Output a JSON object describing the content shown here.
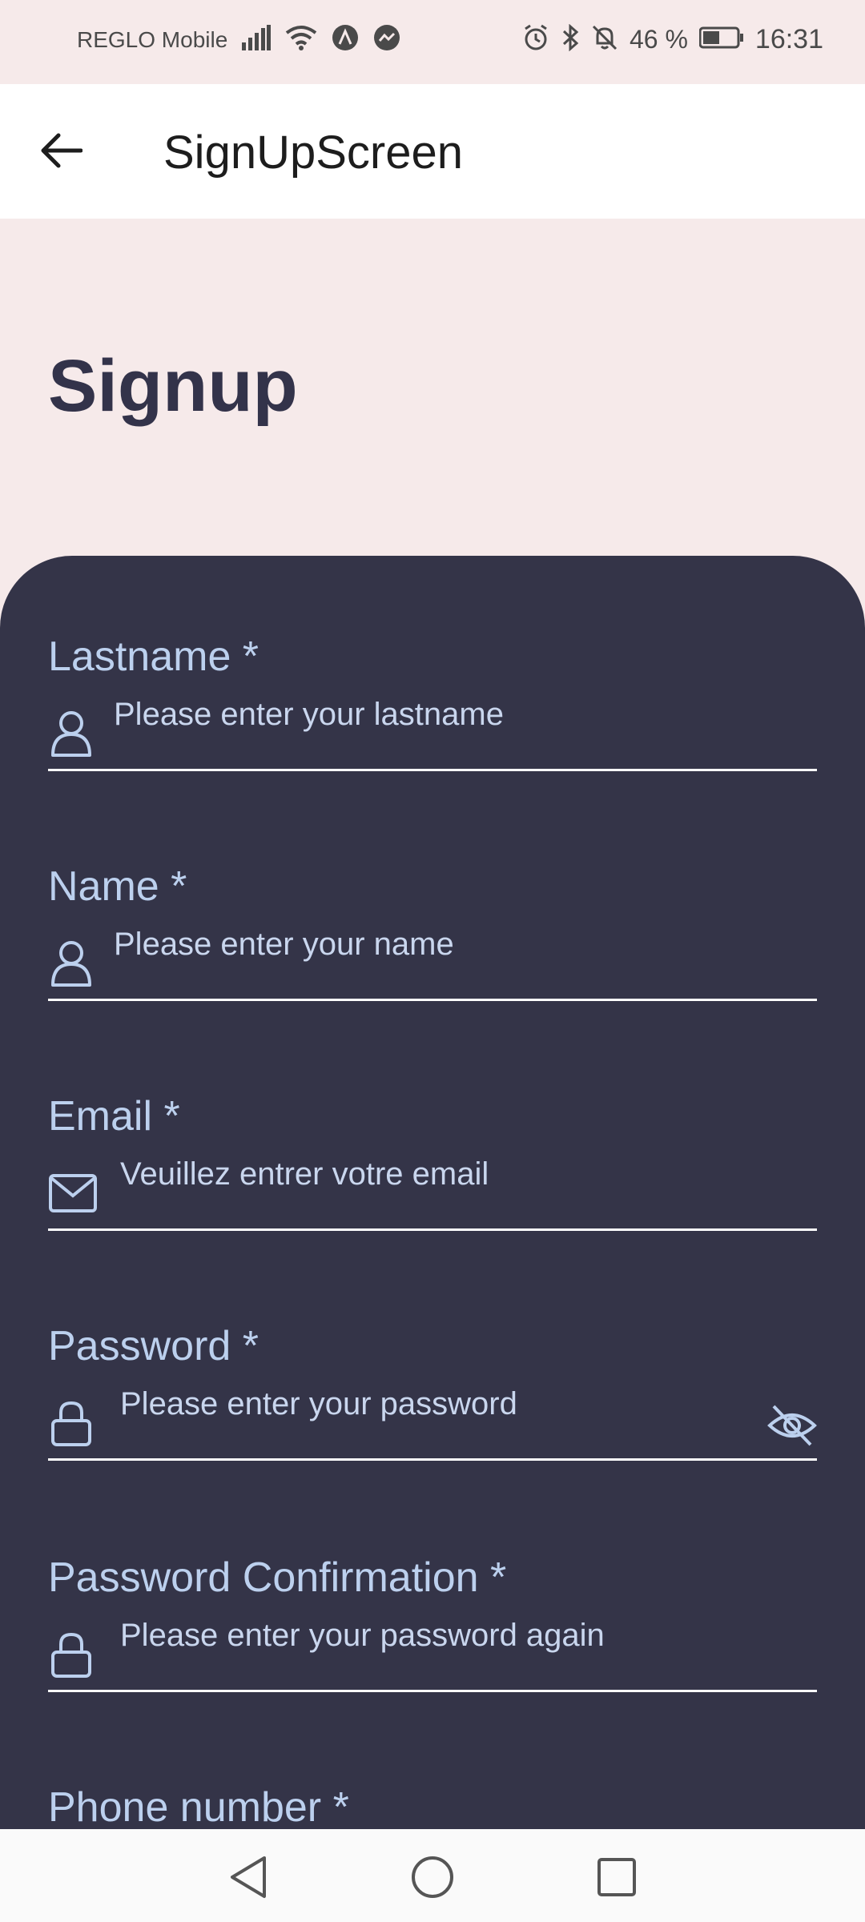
{
  "status_bar": {
    "carrier": "REGLO Mobile",
    "battery_pct": "46 %",
    "time": "16:31",
    "icons": [
      "signal-icon",
      "wifi-icon",
      "app-notification-icon",
      "messenger-icon",
      "alarm-icon",
      "bluetooth-icon",
      "mute-icon",
      "battery-icon"
    ]
  },
  "app_bar": {
    "title": "SignUpScreen",
    "back_icon": "arrow-left-icon"
  },
  "page": {
    "heading": "Signup"
  },
  "form": {
    "fields": [
      {
        "label": "Lastname *",
        "placeholder": "Please enter your lastname",
        "icon": "user-icon"
      },
      {
        "label": "Name *",
        "placeholder": "Please enter your name",
        "icon": "user-icon"
      },
      {
        "label": "Email *",
        "placeholder": "Veuillez entrer votre email",
        "icon": "mail-icon"
      },
      {
        "label": "Password *",
        "placeholder": "Please enter your password",
        "icon": "lock-icon",
        "toggle_icon": "eye-off-icon"
      },
      {
        "label": "Password Confirmation *",
        "placeholder": "Please enter your password again",
        "icon": "lock-icon"
      },
      {
        "label": "Phone number *"
      }
    ]
  },
  "nav_bar": {
    "icons": [
      "back-triangle-icon",
      "home-circle-icon",
      "recents-square-icon"
    ]
  },
  "colors": {
    "background": "#f6eaea",
    "card": "#343448",
    "label": "#bcd0ee",
    "title": "#33334a"
  }
}
